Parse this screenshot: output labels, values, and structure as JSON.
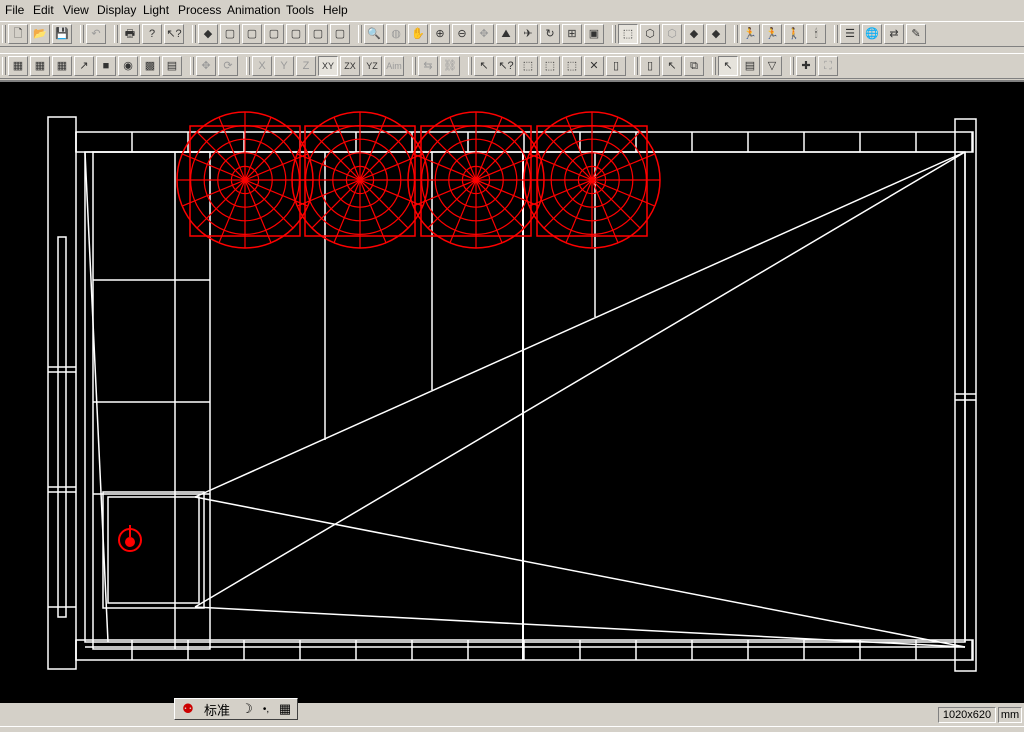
{
  "menu": {
    "items": [
      {
        "name": "menu-file",
        "label": "File"
      },
      {
        "name": "menu-edit",
        "label": "Edit"
      },
      {
        "name": "menu-view",
        "label": "View"
      },
      {
        "name": "menu-display",
        "label": "Display"
      },
      {
        "name": "menu-light",
        "label": "Light"
      },
      {
        "name": "menu-process",
        "label": "Process"
      },
      {
        "name": "menu-animation",
        "label": "Animation"
      },
      {
        "name": "menu-tools",
        "label": "Tools"
      },
      {
        "name": "menu-help",
        "label": "Help"
      }
    ]
  },
  "toolbar1": [
    {
      "name": "new-file-icon",
      "glyph": "🗋"
    },
    {
      "name": "open-folder-icon",
      "glyph": "📂"
    },
    {
      "name": "save-icon",
      "glyph": "💾"
    },
    {
      "name": "undo-icon",
      "glyph": "↶",
      "dim": true
    },
    {
      "name": "print-icon",
      "glyph": "🖶"
    },
    {
      "name": "help-icon",
      "glyph": "?"
    },
    {
      "name": "context-help-icon",
      "glyph": "↖?"
    },
    {
      "name": "select-object-icon",
      "glyph": "◆"
    },
    {
      "name": "box-view-1-icon",
      "glyph": "▢"
    },
    {
      "name": "box-view-2-icon",
      "glyph": "▢"
    },
    {
      "name": "box-view-3-icon",
      "glyph": "▢"
    },
    {
      "name": "box-view-4-icon",
      "glyph": "▢"
    },
    {
      "name": "box-view-5-icon",
      "glyph": "▢"
    },
    {
      "name": "box-view-6-icon",
      "glyph": "▢"
    },
    {
      "name": "zoom-region-icon",
      "glyph": "🔍",
      "dim": true
    },
    {
      "name": "orbit-icon",
      "glyph": "◍",
      "dim": true
    },
    {
      "name": "walk-icon",
      "glyph": "✋",
      "dim": true
    },
    {
      "name": "zoom-in-icon",
      "glyph": "⊕"
    },
    {
      "name": "zoom-out-icon",
      "glyph": "⊖"
    },
    {
      "name": "pan-icon",
      "glyph": "✥",
      "dim": true
    },
    {
      "name": "terrain-icon",
      "glyph": "⛰"
    },
    {
      "name": "flyby-icon",
      "glyph": "✈"
    },
    {
      "name": "rotate-view-icon",
      "glyph": "↻"
    },
    {
      "name": "zoom-extents-icon",
      "glyph": "⊞"
    },
    {
      "name": "camera-view-icon",
      "glyph": "▣"
    },
    {
      "name": "render-wire-icon",
      "glyph": "⬚",
      "pressed": true
    },
    {
      "name": "render-green-wire-icon",
      "glyph": "⬡"
    },
    {
      "name": "render-hidden-icon",
      "glyph": "⬡",
      "dim": true
    },
    {
      "name": "render-solid-icon",
      "glyph": "◆"
    },
    {
      "name": "render-shaded-icon",
      "glyph": "◆"
    },
    {
      "name": "run-animation-icon",
      "glyph": "🏃",
      "dim": true
    },
    {
      "name": "animate-figure-icon",
      "glyph": "🏃"
    },
    {
      "name": "walker-icon",
      "glyph": "🚶"
    },
    {
      "name": "candle-icon",
      "glyph": "🕯"
    },
    {
      "name": "layers-icon",
      "glyph": "☰"
    },
    {
      "name": "globe-icon",
      "glyph": "🌐"
    },
    {
      "name": "export-icon",
      "glyph": "⇄"
    },
    {
      "name": "wizard-icon",
      "glyph": "✎"
    }
  ],
  "toolbar2": [
    {
      "name": "object-1-icon",
      "glyph": "▦"
    },
    {
      "name": "object-2-icon",
      "glyph": "▦"
    },
    {
      "name": "object-3-icon",
      "glyph": "▦"
    },
    {
      "name": "measure-icon",
      "glyph": "↗"
    },
    {
      "name": "yellow-rect-icon",
      "glyph": "■"
    },
    {
      "name": "texture-globe-icon",
      "glyph": "◉"
    },
    {
      "name": "texture-grid-icon",
      "glyph": "▩"
    },
    {
      "name": "material-icon",
      "glyph": "▤"
    },
    {
      "name": "move-icon",
      "glyph": "✥",
      "dim": true
    },
    {
      "name": "rotate-icon",
      "glyph": "⟳",
      "dim": true
    },
    {
      "name": "axis-x-icon",
      "glyph": "X",
      "dim": true
    },
    {
      "name": "axis-y-icon",
      "glyph": "Y",
      "dim": true
    },
    {
      "name": "axis-z-icon",
      "glyph": "Z",
      "dim": true
    },
    {
      "name": "plane-xy-icon",
      "glyph": "XY",
      "pressed": true
    },
    {
      "name": "plane-zx-icon",
      "glyph": "ZX"
    },
    {
      "name": "plane-yz-icon",
      "glyph": "YZ"
    },
    {
      "name": "aim-icon",
      "glyph": "Aim",
      "dim": true
    },
    {
      "name": "align-icon",
      "glyph": "⇆",
      "dim": true
    },
    {
      "name": "link-icon",
      "glyph": "⛓",
      "dim": true
    },
    {
      "name": "select-pointer-icon",
      "glyph": "↖"
    },
    {
      "name": "select-help-icon",
      "glyph": "↖?"
    },
    {
      "name": "select-region-1-icon",
      "glyph": "⬚"
    },
    {
      "name": "select-region-2-icon",
      "glyph": "⬚"
    },
    {
      "name": "select-region-3-icon",
      "glyph": "⬚"
    },
    {
      "name": "deselect-icon",
      "glyph": "✕"
    },
    {
      "name": "page-1-icon",
      "glyph": "▯"
    },
    {
      "name": "page-2-icon",
      "glyph": "▯"
    },
    {
      "name": "cursor-box-icon",
      "glyph": "↖"
    },
    {
      "name": "copy-icon",
      "glyph": "⧉"
    },
    {
      "name": "arrow-pick-icon",
      "glyph": "↖",
      "pressed": true
    },
    {
      "name": "filter-icon",
      "glyph": "▤"
    },
    {
      "name": "filter-pick-icon",
      "glyph": "▽"
    },
    {
      "name": "add-point-icon",
      "glyph": "✚"
    },
    {
      "name": "hierarchy-icon",
      "glyph": "⛶",
      "dim": true
    }
  ],
  "ime": {
    "label": "标准",
    "moon": "☽",
    "dots": "•,",
    "kbd": "▦"
  },
  "status": {
    "resolution": "1020x620",
    "units": "mm"
  },
  "colors": {
    "wire": "#ffffff",
    "light": "#ff0000",
    "viewport_bg": "#000000"
  }
}
